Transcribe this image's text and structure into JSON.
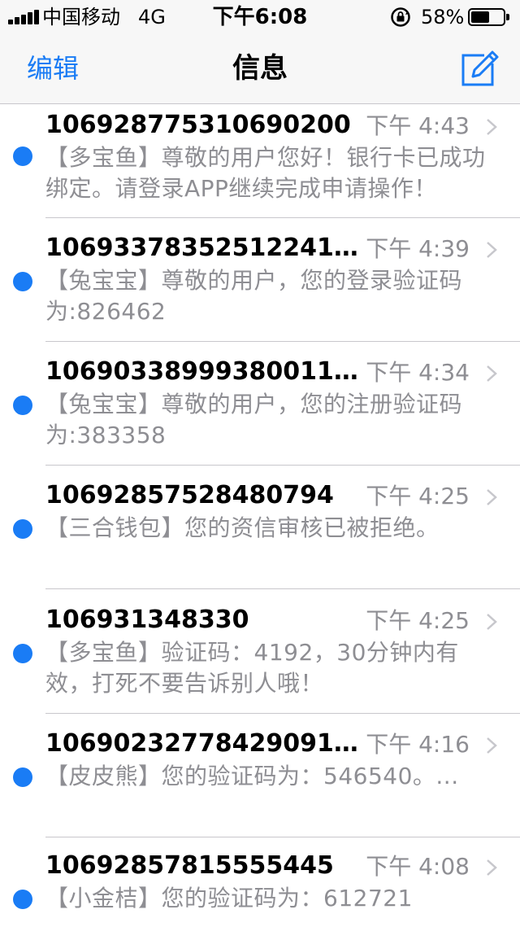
{
  "status_bar": {
    "carrier": "中国移动",
    "network": "4G",
    "time": "下午6:08",
    "battery_percent_text": "58%",
    "battery_level": 0.58
  },
  "nav": {
    "edit_label": "编辑",
    "title": "信息"
  },
  "colors": {
    "accent": "#1a7cf5",
    "secondary_text": "#8e8e93",
    "separator": "#c8c7cc",
    "bar_background": "#f7f7f7"
  },
  "messages": [
    {
      "sender": "106928775310690200",
      "time": "下午 4:43",
      "preview": "【多宝鱼】尊敬的用户您好！银行卡已成功绑定。请登录APP继续完成申请操作！",
      "unread": true
    },
    {
      "sender": "10693378352512241...",
      "time": "下午 4:39",
      "preview": "【兔宝宝】尊敬的用户，您的登录验证码为:826462",
      "unread": true
    },
    {
      "sender": "10690338999380011...",
      "time": "下午 4:34",
      "preview": "【兔宝宝】尊敬的用户，您的注册验证码为:383358",
      "unread": true
    },
    {
      "sender": "106928575284807​94",
      "time": "下午 4:25",
      "preview": "【三合钱包】您的资信审核已被拒绝。",
      "unread": true
    },
    {
      "sender": "106931348330",
      "time": "下午 4:25",
      "preview": "【多宝鱼】验证码：4192，30分钟内有效，打死不要告诉别人哦！",
      "unread": true
    },
    {
      "sender": "10690232778429091...",
      "time": "下午 4:16",
      "preview": "【皮皮熊】您的验证码为：546540。...",
      "unread": true
    },
    {
      "sender": "10692857815555445",
      "time": "下午 4:08",
      "preview": "【小金桔】您的验证码为：612721",
      "unread": true
    }
  ]
}
